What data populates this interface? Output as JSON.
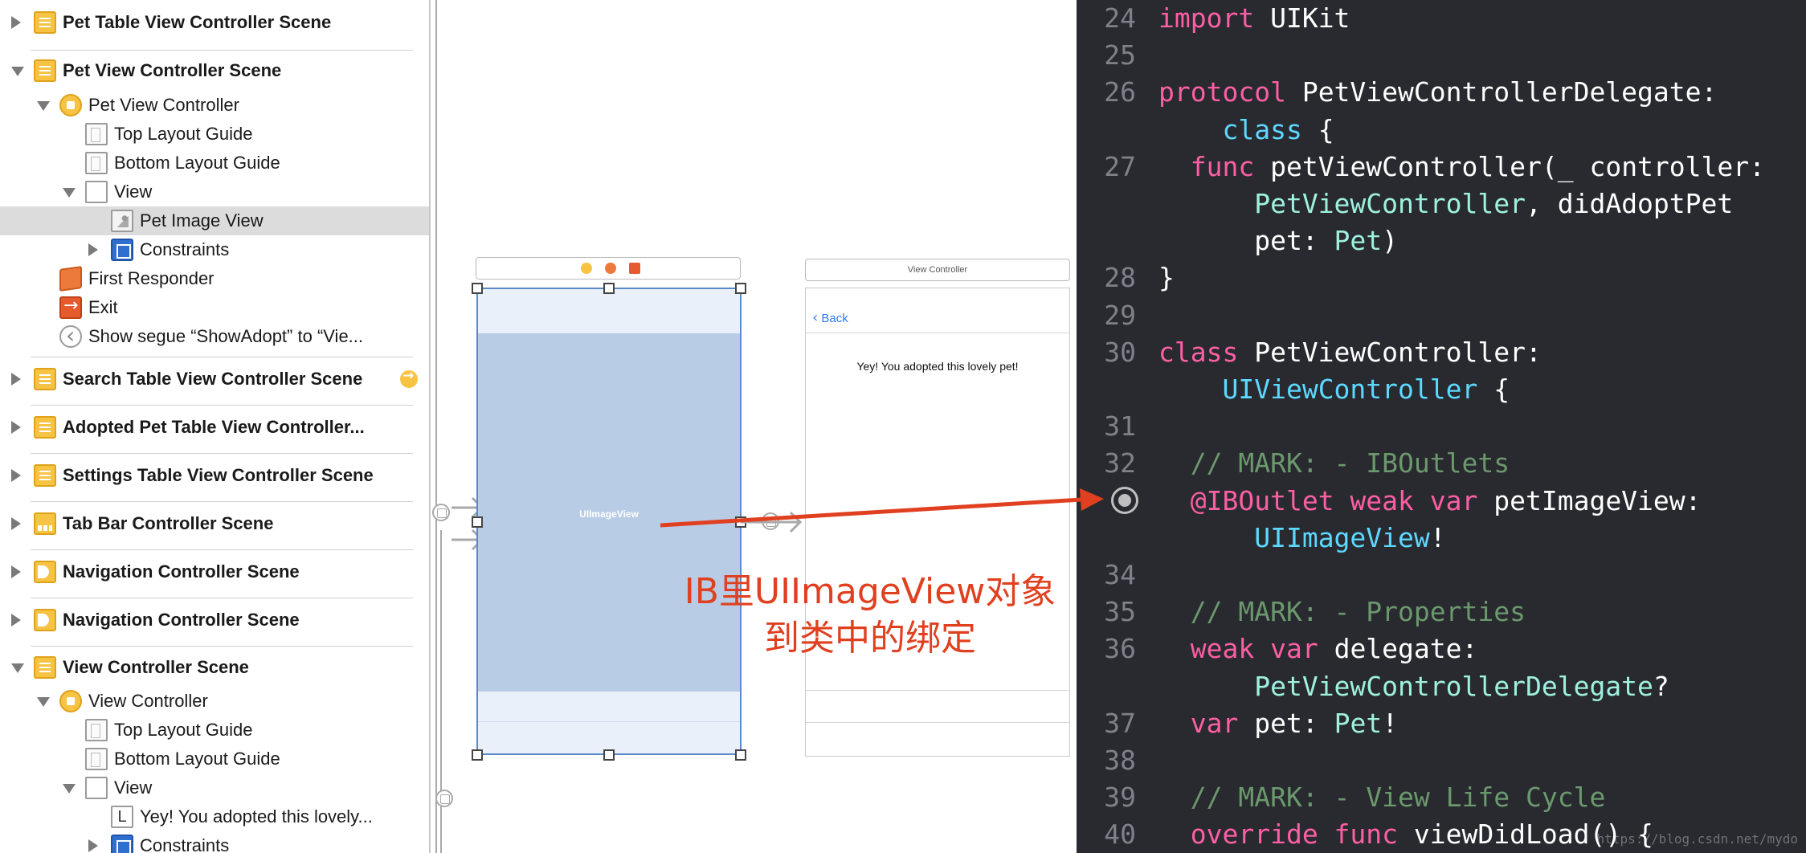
{
  "outline": {
    "items": [
      {
        "label": "Pet Table View Controller Scene",
        "kind": "scene",
        "icon": "scene-icon",
        "disclosure": "closed"
      },
      {
        "label": "Pet View Controller Scene",
        "kind": "scene",
        "icon": "scene-icon",
        "disclosure": "open"
      },
      {
        "label": "Pet View Controller",
        "kind": "item",
        "icon": "view-controller-icon",
        "disclosure": "open"
      },
      {
        "label": "Top Layout Guide",
        "kind": "item",
        "icon": "layout-guide-icon"
      },
      {
        "label": "Bottom Layout Guide",
        "kind": "item",
        "icon": "layout-guide-icon"
      },
      {
        "label": "View",
        "kind": "item",
        "icon": "view-icon",
        "disclosure": "open"
      },
      {
        "label": "Pet Image View",
        "kind": "item",
        "icon": "image-view-icon",
        "selected": true
      },
      {
        "label": "Constraints",
        "kind": "item",
        "icon": "constraints-icon",
        "disclosure": "closed"
      },
      {
        "label": "First Responder",
        "kind": "item",
        "icon": "first-responder-icon"
      },
      {
        "label": "Exit",
        "kind": "item",
        "icon": "exit-icon"
      },
      {
        "label": "Show segue “ShowAdopt” to “Vie...",
        "kind": "item",
        "icon": "segue-icon"
      },
      {
        "label": "Search Table View Controller Scene",
        "kind": "scene",
        "icon": "scene-icon",
        "disclosure": "closed",
        "entry_point": true
      },
      {
        "label": "Adopted Pet Table View Controller...",
        "kind": "scene",
        "icon": "scene-icon",
        "disclosure": "closed"
      },
      {
        "label": "Settings Table View Controller Scene",
        "kind": "scene",
        "icon": "scene-icon",
        "disclosure": "closed"
      },
      {
        "label": "Tab Bar Controller Scene",
        "kind": "scene",
        "icon": "tab-bar-icon",
        "disclosure": "closed"
      },
      {
        "label": "Navigation Controller Scene",
        "kind": "scene",
        "icon": "navigation-icon",
        "disclosure": "closed"
      },
      {
        "label": "Navigation Controller Scene",
        "kind": "scene",
        "icon": "navigation-icon",
        "disclosure": "closed"
      },
      {
        "label": "View Controller Scene",
        "kind": "scene",
        "icon": "scene-icon",
        "disclosure": "open"
      },
      {
        "label": "View Controller",
        "kind": "item",
        "icon": "view-controller-icon",
        "disclosure": "open"
      },
      {
        "label": "Top Layout Guide",
        "kind": "item",
        "icon": "layout-guide-icon"
      },
      {
        "label": "Bottom Layout Guide",
        "kind": "item",
        "icon": "layout-guide-icon"
      },
      {
        "label": "View",
        "kind": "item",
        "icon": "view-icon",
        "disclosure": "open"
      },
      {
        "label": "Yey! You adopted this lovely...",
        "kind": "item",
        "icon": "label-icon",
        "icon_text": "L"
      },
      {
        "label": "Constraints",
        "kind": "item",
        "icon": "constraints-icon",
        "disclosure": "closed"
      }
    ]
  },
  "canvas": {
    "pet_scene": {
      "image_view_label": "UIImageView"
    },
    "adopt_scene": {
      "title": "View Controller",
      "back_label": "Back",
      "message": "Yey! You adopted this lovely pet!"
    },
    "annotation": {
      "line1": "IB里UIImageView对象",
      "line2": "到类中的绑定",
      "color": "#e0401f"
    }
  },
  "editor": {
    "colors": {
      "background": "#292a30",
      "keyword": "#fc5fa3",
      "type": "#5dd8ff",
      "project_type": "#9ef1dd",
      "comment": "#6c986e",
      "line_number": "#7f8088"
    },
    "lines": [
      {
        "n": "24",
        "tokens": [
          [
            "kw",
            "import"
          ],
          [
            "tx",
            " UIKit"
          ]
        ]
      },
      {
        "n": "25",
        "tokens": []
      },
      {
        "n": "26",
        "tokens": [
          [
            "kw",
            "protocol"
          ],
          [
            "tx",
            " PetViewControllerDelegate:"
          ]
        ]
      },
      {
        "n": "",
        "tokens": [
          [
            "tx",
            "    "
          ],
          [
            "ty",
            "class"
          ],
          [
            "tx",
            " {"
          ]
        ]
      },
      {
        "n": "27",
        "tokens": [
          [
            "tx",
            "  "
          ],
          [
            "kw",
            "func"
          ],
          [
            "tx",
            " petViewController(_ controller:"
          ]
        ]
      },
      {
        "n": "",
        "tokens": [
          [
            "tx",
            "      "
          ],
          [
            "tn",
            "PetViewController"
          ],
          [
            "tx",
            ", didAdoptPet"
          ]
        ]
      },
      {
        "n": "",
        "tokens": [
          [
            "tx",
            "      pet: "
          ],
          [
            "tn",
            "Pet"
          ],
          [
            "tx",
            ")"
          ]
        ]
      },
      {
        "n": "28",
        "tokens": [
          [
            "tx",
            "}"
          ]
        ]
      },
      {
        "n": "29",
        "tokens": []
      },
      {
        "n": "30",
        "tokens": [
          [
            "kw",
            "class"
          ],
          [
            "tx",
            " PetViewController:"
          ]
        ]
      },
      {
        "n": "",
        "tokens": [
          [
            "tx",
            "    "
          ],
          [
            "ty",
            "UIViewController"
          ],
          [
            "tx",
            " {"
          ]
        ]
      },
      {
        "n": "31",
        "tokens": []
      },
      {
        "n": "32",
        "tokens": [
          [
            "tx",
            "  "
          ],
          [
            "cm",
            "// MARK: - IBOutlets"
          ]
        ]
      },
      {
        "n": "",
        "tokens": [
          [
            "tx",
            "  "
          ],
          [
            "kw",
            "@IBOutlet weak var"
          ],
          [
            "tx",
            " petImageView:"
          ]
        ],
        "outlet_connected": true
      },
      {
        "n": "",
        "tokens": [
          [
            "tx",
            "      "
          ],
          [
            "ty",
            "UIImageView"
          ],
          [
            "tx",
            "!"
          ]
        ]
      },
      {
        "n": "34",
        "tokens": []
      },
      {
        "n": "35",
        "tokens": [
          [
            "tx",
            "  "
          ],
          [
            "cm",
            "// MARK: - Properties"
          ]
        ]
      },
      {
        "n": "36",
        "tokens": [
          [
            "tx",
            "  "
          ],
          [
            "kw",
            "weak var"
          ],
          [
            "tx",
            " delegate:"
          ]
        ]
      },
      {
        "n": "",
        "tokens": [
          [
            "tx",
            "      "
          ],
          [
            "tn",
            "PetViewControllerDelegate"
          ],
          [
            "tx",
            "?"
          ]
        ]
      },
      {
        "n": "37",
        "tokens": [
          [
            "tx",
            "  "
          ],
          [
            "kw",
            "var"
          ],
          [
            "tx",
            " pet: "
          ],
          [
            "tn",
            "Pet"
          ],
          [
            "tx",
            "!"
          ]
        ]
      },
      {
        "n": "38",
        "tokens": []
      },
      {
        "n": "39",
        "tokens": [
          [
            "tx",
            "  "
          ],
          [
            "cm",
            "// MARK: - View Life Cycle"
          ]
        ]
      },
      {
        "n": "40",
        "tokens": [
          [
            "tx",
            "  "
          ],
          [
            "kw",
            "override func"
          ],
          [
            "tx",
            " viewDidLoad() {"
          ]
        ]
      }
    ],
    "watermark": "https://blog.csdn.net/mydo"
  }
}
